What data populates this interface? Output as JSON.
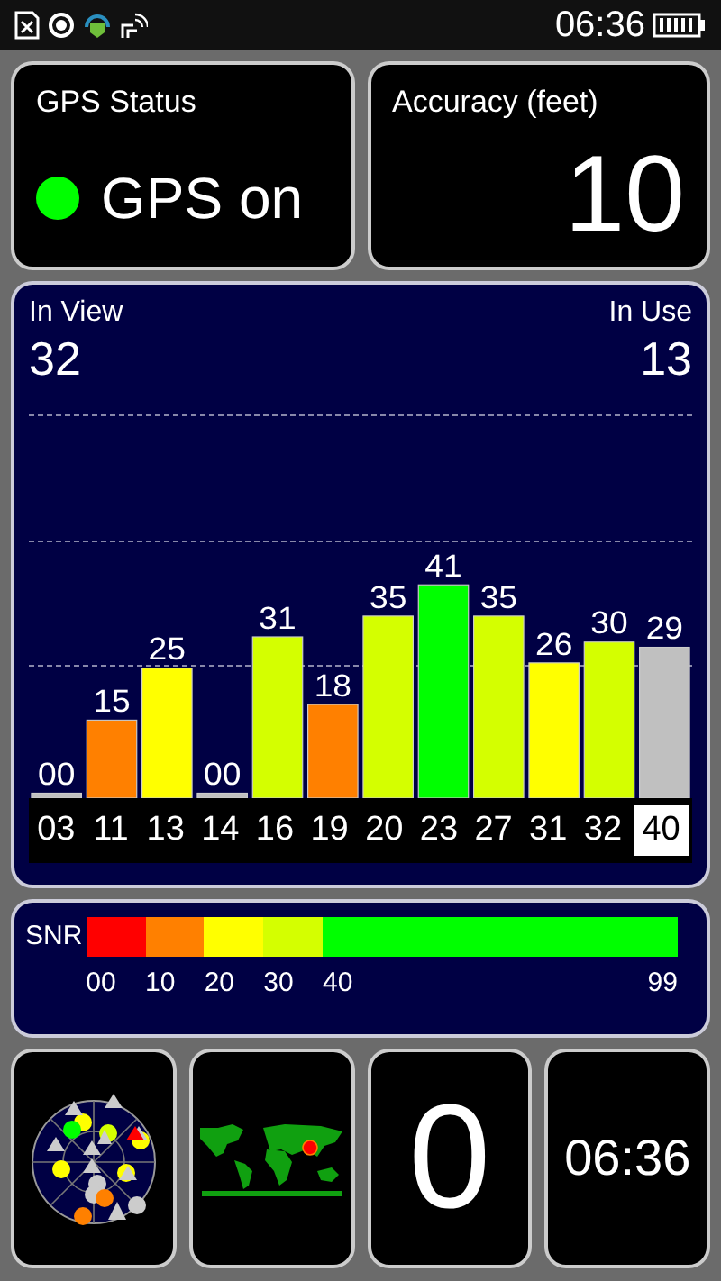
{
  "status_bar": {
    "time": "06:36"
  },
  "gps_status": {
    "title": "GPS Status",
    "text": "GPS on",
    "on": true
  },
  "accuracy": {
    "title": "Accuracy (feet)",
    "value": "10"
  },
  "satellites_panel": {
    "in_view_label": "In View",
    "in_view": "32",
    "in_use_label": "In Use",
    "in_use": "13",
    "chart_data": {
      "type": "bar",
      "categories": [
        "03",
        "11",
        "13",
        "14",
        "16",
        "19",
        "20",
        "23",
        "27",
        "31",
        "32",
        "40"
      ],
      "values": [
        0,
        15,
        25,
        0,
        31,
        18,
        35,
        41,
        35,
        26,
        30,
        29
      ],
      "value_labels": [
        "00",
        "15",
        "25",
        "00",
        "31",
        "18",
        "35",
        "41",
        "35",
        "26",
        "30",
        "29"
      ]
    },
    "bars": [
      {
        "in_use": false,
        "selected": false
      },
      {
        "in_use": true,
        "selected": false
      },
      {
        "in_use": true,
        "selected": false
      },
      {
        "in_use": false,
        "selected": false
      },
      {
        "in_use": true,
        "selected": false
      },
      {
        "in_use": true,
        "selected": false
      },
      {
        "in_use": true,
        "selected": false
      },
      {
        "in_use": true,
        "selected": false
      },
      {
        "in_use": true,
        "selected": false
      },
      {
        "in_use": true,
        "selected": false
      },
      {
        "in_use": true,
        "selected": false
      },
      {
        "in_use": false,
        "selected": true
      }
    ]
  },
  "snr_legend": {
    "label": "SNR",
    "segments": [
      {
        "label": "00",
        "color": "#ff0000"
      },
      {
        "label": "10",
        "color": "#ff8000"
      },
      {
        "label": "20",
        "color": "#ffff00"
      },
      {
        "label": "30",
        "color": "#d4ff00"
      },
      {
        "label": "40",
        "color": "#00ff00"
      }
    ],
    "max_label": "99"
  },
  "tiles": {
    "counter": "0",
    "clock": "06:36"
  }
}
